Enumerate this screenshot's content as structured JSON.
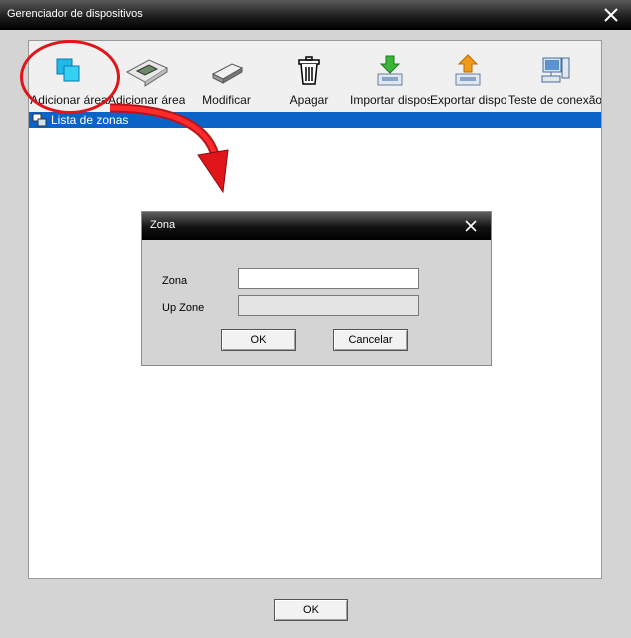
{
  "window": {
    "title": "Gerenciador de dispositivos"
  },
  "toolbar": {
    "items": [
      {
        "label": "Adicionar área",
        "icon": "add-area-icon"
      },
      {
        "label": "Adicionar área",
        "icon": "circuit-board-icon"
      },
      {
        "label": "Modificar",
        "icon": "usb-drive-icon"
      },
      {
        "label": "Apagar",
        "icon": "trash-icon"
      },
      {
        "label": "Importar dispositivo",
        "icon": "import-icon"
      },
      {
        "label": "Exportar dispositivo",
        "icon": "export-icon"
      },
      {
        "label": "Teste de conexão",
        "icon": "network-test-icon"
      }
    ]
  },
  "zone_list": {
    "header": "Lista de zonas"
  },
  "dialog": {
    "title": "Zona",
    "zone_label": "Zona",
    "zone_value": "",
    "up_zone_label": "Up Zone",
    "up_zone_value": "",
    "ok_label": "OK",
    "cancel_label": "Cancelar"
  },
  "footer": {
    "ok_label": "OK"
  },
  "colors": {
    "highlight": "#e0151a",
    "selection": "#0a64c8"
  }
}
